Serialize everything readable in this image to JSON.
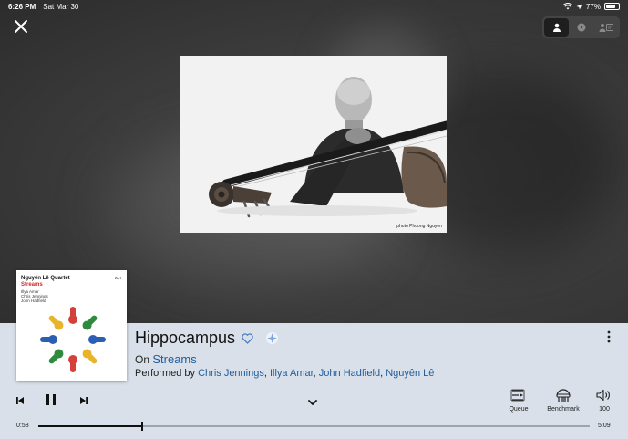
{
  "status_bar": {
    "time": "6:26 PM",
    "date": "Sat Mar 30",
    "battery": "77%",
    "battery_level": 0.77
  },
  "top_controls": {
    "close_icon": "close-icon",
    "view_options": [
      "artist-photo-icon",
      "album-art-icon",
      "lyrics-icon"
    ],
    "selected_view": 0
  },
  "artist_photo": {
    "credit": "photo Phuong Nguyen"
  },
  "album_art": {
    "artist": "Nguyên Lê Quartet",
    "title": "Streams",
    "personnel": [
      "Illya Amar",
      "Chris Jennings",
      "John Hadfield"
    ],
    "label": "ACT"
  },
  "now_playing": {
    "title": "Hippocampus",
    "on_prefix": "On",
    "album": "Streams",
    "performed_by_prefix": "Performed by",
    "performers": [
      "Chris Jennings",
      "Illya Amar",
      "John Hadfield",
      "Nguyên Lê"
    ]
  },
  "controls": {
    "queue_label": "Queue",
    "benchmark_label": "Benchmark",
    "volume": "100"
  },
  "progress": {
    "elapsed": "0:58",
    "duration": "5:09",
    "fraction": 0.188
  },
  "colors": {
    "panel_bg": "#d9e0ea",
    "link": "#1f5d9c",
    "accent": "#4a7fc0"
  }
}
